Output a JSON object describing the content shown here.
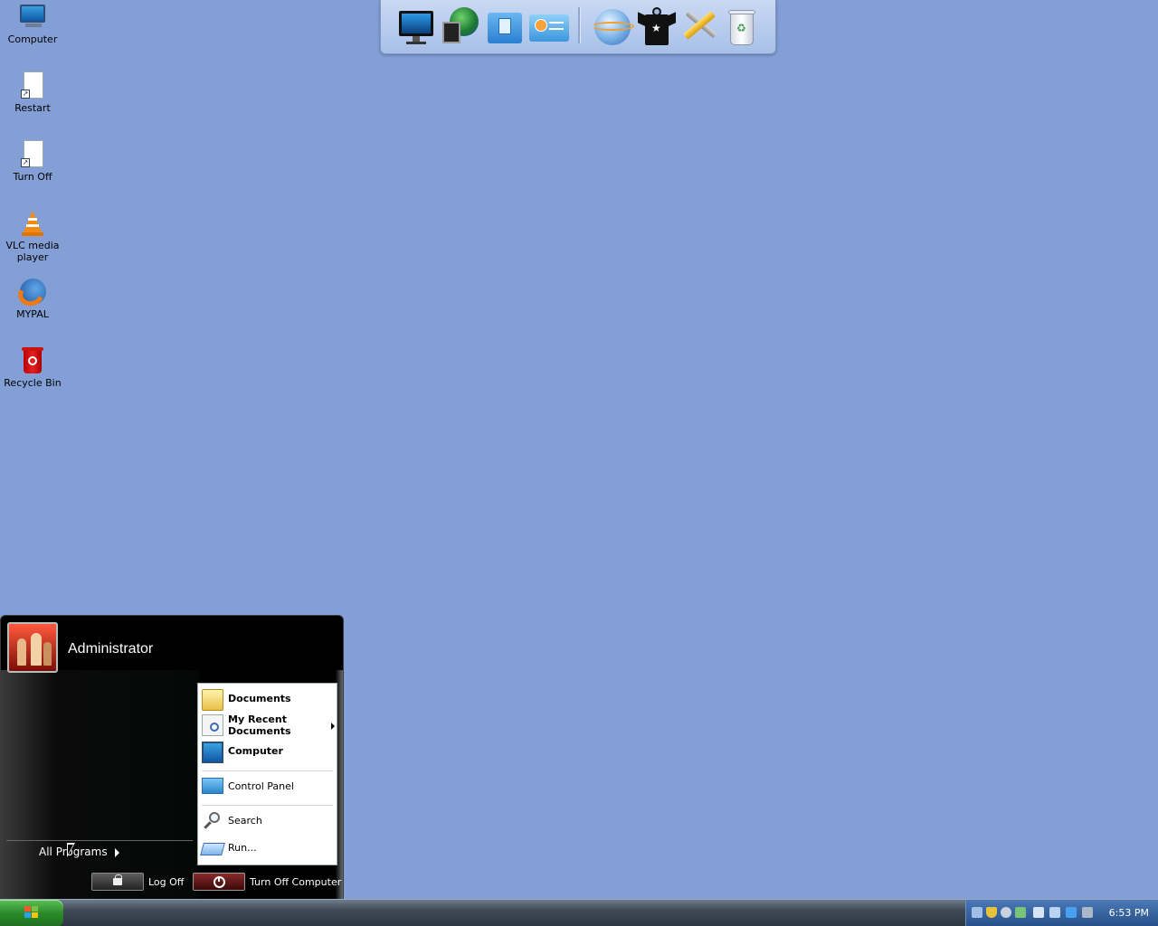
{
  "desktop": {
    "icons": [
      {
        "label": "Computer",
        "icon": "computer-icon"
      },
      {
        "label": "Restart",
        "icon": "shortcut-file-icon"
      },
      {
        "label": "Turn Off",
        "icon": "shortcut-file-icon"
      },
      {
        "label": "VLC media player",
        "icon": "vlc-cone-icon"
      },
      {
        "label": "MYPAL",
        "icon": "browser-globe-icon"
      },
      {
        "label": "Recycle Bin",
        "icon": "recycle-bin-icon"
      }
    ],
    "background_color": "#839fd6"
  },
  "dock": {
    "items": [
      "monitor-icon",
      "network-globe-icon",
      "folder-icon",
      "control-panel-icon",
      "world-icon",
      "tshirt-icon",
      "tools-icon",
      "trash-icon"
    ]
  },
  "start_menu": {
    "user_name": "Administrator",
    "all_programs_label": "All Programs",
    "places": [
      {
        "label": "Documents",
        "icon": "documents-folder-icon",
        "bold": true
      },
      {
        "label": "My Recent Documents",
        "icon": "recent-documents-icon",
        "bold": true,
        "submenu": true
      },
      {
        "label": "Computer",
        "icon": "computer-icon",
        "bold": true
      },
      {
        "label": "Control Panel",
        "icon": "control-panel-icon",
        "bold": false
      },
      {
        "label": "Search",
        "icon": "search-icon",
        "bold": false
      },
      {
        "label": "Run...",
        "icon": "run-icon",
        "bold": false
      }
    ],
    "log_off_label": "Log Off",
    "turn_off_label": "Turn Off Computer"
  },
  "taskbar": {
    "start_label": "",
    "clock": "6:53 PM",
    "tray_icons": [
      "network-icon",
      "security-shield-icon",
      "antivirus-icon",
      "safely-remove-icon",
      "tray-app-icon",
      "display-icon",
      "tray-window-icon",
      "volume-icon"
    ]
  }
}
